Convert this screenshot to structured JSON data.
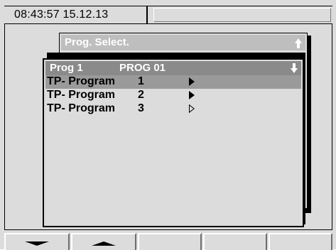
{
  "status": {
    "clock": "08:43:57  15.12.13"
  },
  "back_window": {
    "title": "Prog. Select.",
    "scroll_icon": "arrow-up-icon"
  },
  "front_window": {
    "title_left": "Prog 1",
    "title_right": "PROG 01",
    "scroll_icon": "arrow-down-icon",
    "items": [
      {
        "name": "TP- Program",
        "number": "1",
        "selected": true
      },
      {
        "name": "TP- Program",
        "number": "2",
        "selected": false
      },
      {
        "name": "TP- Program",
        "number": "3",
        "selected": false
      }
    ]
  },
  "softkeys": [
    {
      "icon": "arrow-down-icon"
    },
    {
      "icon": "arrow-up-icon"
    },
    {
      "icon": ""
    },
    {
      "icon": ""
    },
    {
      "icon": ""
    }
  ],
  "colors": {
    "background": "#dcdcdc",
    "selected_row": "#9a9a9a",
    "title_front": "#8a8a8a",
    "title_back": "#bebebe"
  }
}
